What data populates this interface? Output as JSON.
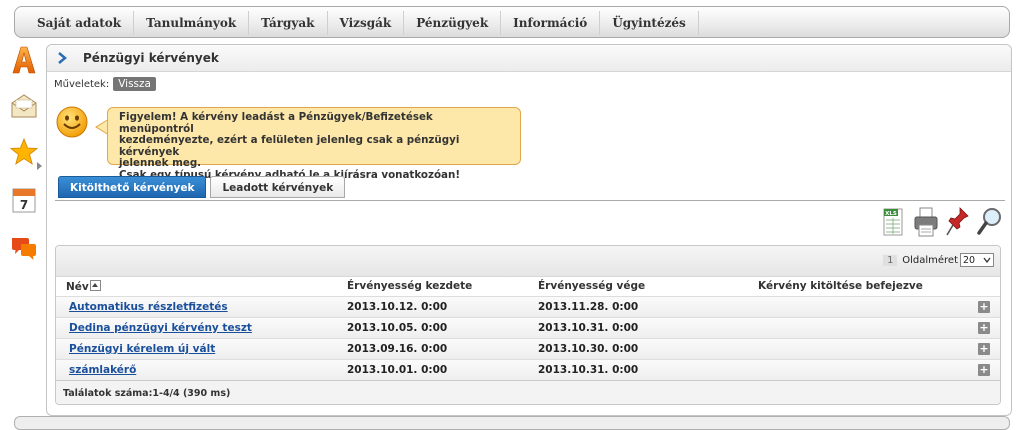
{
  "menu": {
    "items": [
      "Saját adatok",
      "Tanulmányok",
      "Tárgyak",
      "Vizsgák",
      "Pénzügyek",
      "Információ",
      "Ügyintézés"
    ]
  },
  "panel": {
    "title": "Pénzügyi kérvények",
    "actions_label": "Műveletek:",
    "back_label": "Vissza"
  },
  "notice": {
    "lines": [
      "Figyelem! A kérvény leadást a Pénzügyek/Befizetések menüpontról",
      "kezdeményezte, ezért a felületen jelenleg csak a pénzügyi kérvények",
      "jelennek meg.",
      "Csak egy típusú kérvény adható le a kiírásra vonatkozóan!"
    ]
  },
  "tabs": [
    {
      "label": "Kitölthető kérvények"
    },
    {
      "label": "Leadott kérvények"
    }
  ],
  "toolbar": {
    "icons": [
      "excel-export-icon",
      "print-icon",
      "pin-icon",
      "search-icon"
    ],
    "xls_label": "XLS"
  },
  "grid": {
    "page_number": "1",
    "page_size_label": "Oldalméret",
    "page_size_value": "20",
    "columns": [
      "Név",
      "Érvényesség kezdete",
      "Érvényesség vége",
      "Kérvény kitöltése befejezve"
    ],
    "rows": [
      {
        "name": "Automatikus részletfizetés",
        "start": "2013.10.12. 0:00",
        "end": "2013.11.28. 0:00"
      },
      {
        "name": "Dedina pénzügyi kérvény teszt",
        "start": "2013.10.05. 0:00",
        "end": "2013.10.31. 0:00"
      },
      {
        "name": "Pénzügyi kérelem  új vált",
        "start": "2013.09.16. 0:00",
        "end": "2013.10.30. 0:00"
      },
      {
        "name": "számlakérő",
        "start": "2013.10.01. 0:00",
        "end": "2013.10.31. 0:00"
      }
    ],
    "plus_label": "+",
    "count_label": "Találatok száma:1-4/4 (390 ms)"
  },
  "sidebar": {
    "calendar_day": "7"
  }
}
